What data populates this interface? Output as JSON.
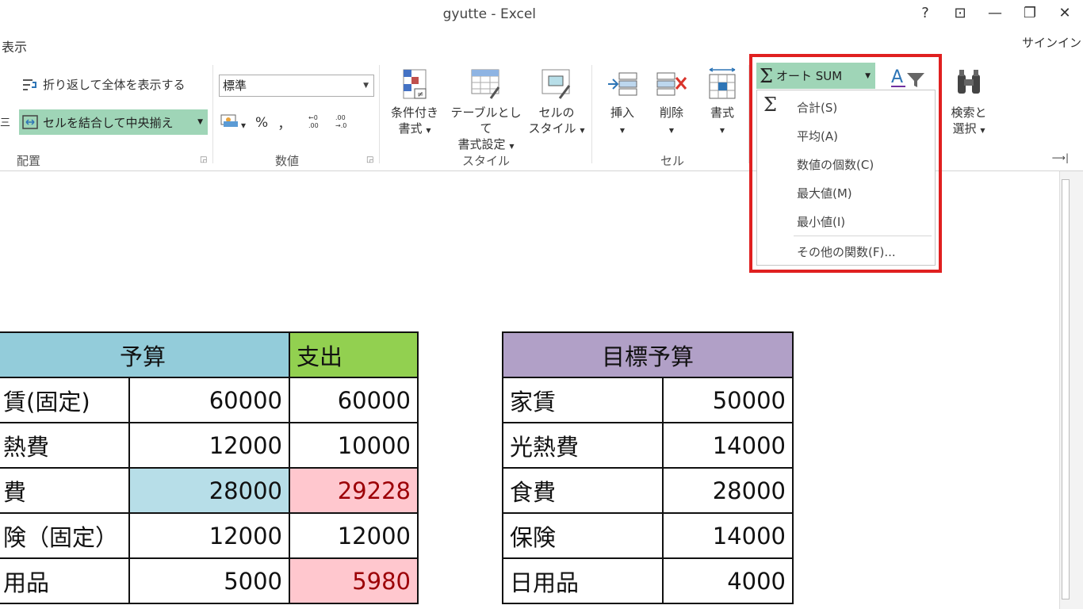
{
  "window": {
    "title": "gyutte - Excel",
    "help": "?",
    "ribbon_display": "⊡",
    "minimize": "—",
    "restore": "❐",
    "close": "✕",
    "menu_view": "表示",
    "signin": "サインイン"
  },
  "ribbon": {
    "alignment": {
      "wrap_text": "折り返して全体を表示する",
      "merge_center": "セルを結合して中央揃え",
      "label": "配置",
      "left_cut": "三"
    },
    "number": {
      "format_value": "標準",
      "percent": "%",
      "comma": "，",
      "label": "数値"
    },
    "styles": {
      "conditional_1": "条件付き",
      "conditional_2": "書式",
      "table_1": "テーブルとして",
      "table_2": "書式設定",
      "cell_styles_1": "セルの",
      "cell_styles_2": "スタイル",
      "label": "スタイル"
    },
    "cells": {
      "insert": "挿入",
      "delete": "削除",
      "format": "書式",
      "label": "セル"
    },
    "editing": {
      "autosum": "オート SUM",
      "find_1": "検索と",
      "find_2": "選択"
    }
  },
  "autosum_menu": {
    "items": [
      "合計(S)",
      "平均(A)",
      "数値の個数(C)",
      "最大値(M)",
      "最小値(I)",
      "その他の関数(F)..."
    ]
  },
  "budget_table": {
    "header_budget": "予算",
    "header_spend": "支出",
    "rows": [
      {
        "label": "賃(固定)",
        "budget": "60000",
        "spend": "60000"
      },
      {
        "label": "熱費",
        "budget": "12000",
        "spend": "10000"
      },
      {
        "label": "費",
        "budget": "28000",
        "spend": "29228"
      },
      {
        "label": "険（固定）",
        "budget": "12000",
        "spend": "12000"
      },
      {
        "label": "用品",
        "budget": "5000",
        "spend": "5980"
      }
    ]
  },
  "target_table": {
    "header": "目標予算",
    "rows": [
      {
        "label": "家賃",
        "value": "50000"
      },
      {
        "label": "光熱費",
        "value": "14000"
      },
      {
        "label": "食費",
        "value": "28000"
      },
      {
        "label": "保険",
        "value": "14000"
      },
      {
        "label": "日用品",
        "value": "4000"
      }
    ]
  },
  "colors": {
    "highlight": "#e02020",
    "selected_button": "#9fd5b7",
    "budget_header": "#93ccda",
    "spend_header": "#92d050",
    "target_header": "#b1a0c7",
    "cell_blue": "#b7dee8",
    "cell_pink": "#ffc7ce"
  }
}
